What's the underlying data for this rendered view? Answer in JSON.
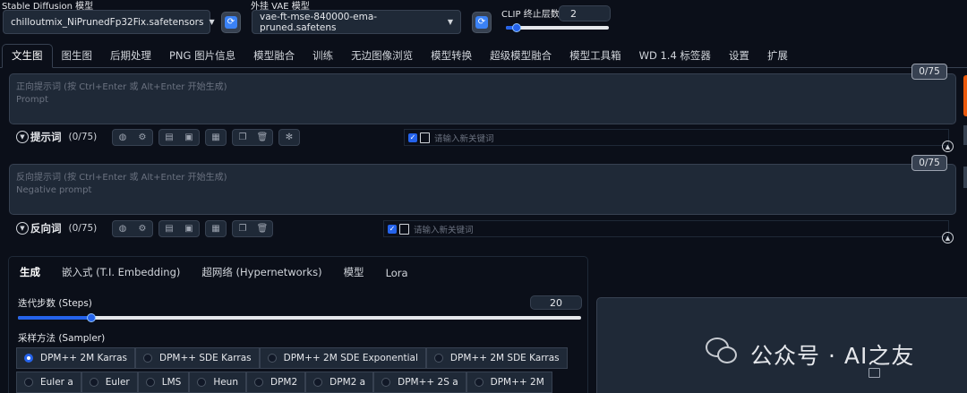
{
  "header": {
    "sd_model_label": "Stable Diffusion 模型",
    "sd_model_value": "chilloutmix_NiPrunedFp32Fix.safetensors",
    "vae_label": "外挂 VAE 模型",
    "vae_value": "vae-ft-mse-840000-ema-pruned.safetens",
    "clip_label": "CLIP 终止层数",
    "clip_value": "2",
    "clip_fraction": 0.1
  },
  "main_tabs": [
    "文生图",
    "图生图",
    "后期处理",
    "PNG 图片信息",
    "模型融合",
    "训练",
    "无边图像浏览",
    "模型转换",
    "超级模型融合",
    "模型工具箱",
    "WD 1.4 标签器",
    "设置",
    "扩展"
  ],
  "prompt": {
    "placeholder_line1": "正向提示词 (按 Ctrl+Enter 或 Alt+Enter 开始生成)",
    "placeholder_line2": "Prompt",
    "counter": "0/75",
    "toolbar_title": "提示词",
    "toolbar_count": "(0/75)",
    "keyword_placeholder": "请输入新关键词"
  },
  "negative": {
    "placeholder_line1": "反向提示词 (按 Ctrl+Enter 或 Alt+Enter 开始生成)",
    "placeholder_line2": "Negative prompt",
    "counter": "0/75",
    "toolbar_title": "反向词",
    "toolbar_count": "(0/75)",
    "keyword_placeholder": "请输入新关键词"
  },
  "sub_tabs": [
    "生成",
    "嵌入式 (T.I. Embedding)",
    "超网络 (Hypernetworks)",
    "模型",
    "Lora"
  ],
  "steps": {
    "label": "迭代步数 (Steps)",
    "value": "20",
    "fraction": 0.13
  },
  "sampler": {
    "label": "采样方法 (Sampler)",
    "row1": [
      "DPM++ 2M Karras",
      "DPM++ SDE Karras",
      "DPM++ 2M SDE Exponential",
      "DPM++ 2M SDE Karras"
    ],
    "row2": [
      "Euler a",
      "Euler",
      "LMS",
      "Heun",
      "DPM2",
      "DPM2 a",
      "DPM++ 2S a",
      "DPM++ 2M"
    ],
    "selected": "DPM++ 2M Karras"
  },
  "watermark": {
    "text": "公众号 · AI之友"
  },
  "icons": {
    "prompt_tools": [
      "globe-icon",
      "gear-icon",
      "clipboard-icon",
      "bookmark-icon",
      "image-icon",
      "copy-icon",
      "trash-icon",
      "settings-icon"
    ]
  },
  "colors": {
    "accent": "#2563eb",
    "background": "#0b0f19",
    "panel": "#1f2937",
    "generate_button": "#ea580c"
  }
}
